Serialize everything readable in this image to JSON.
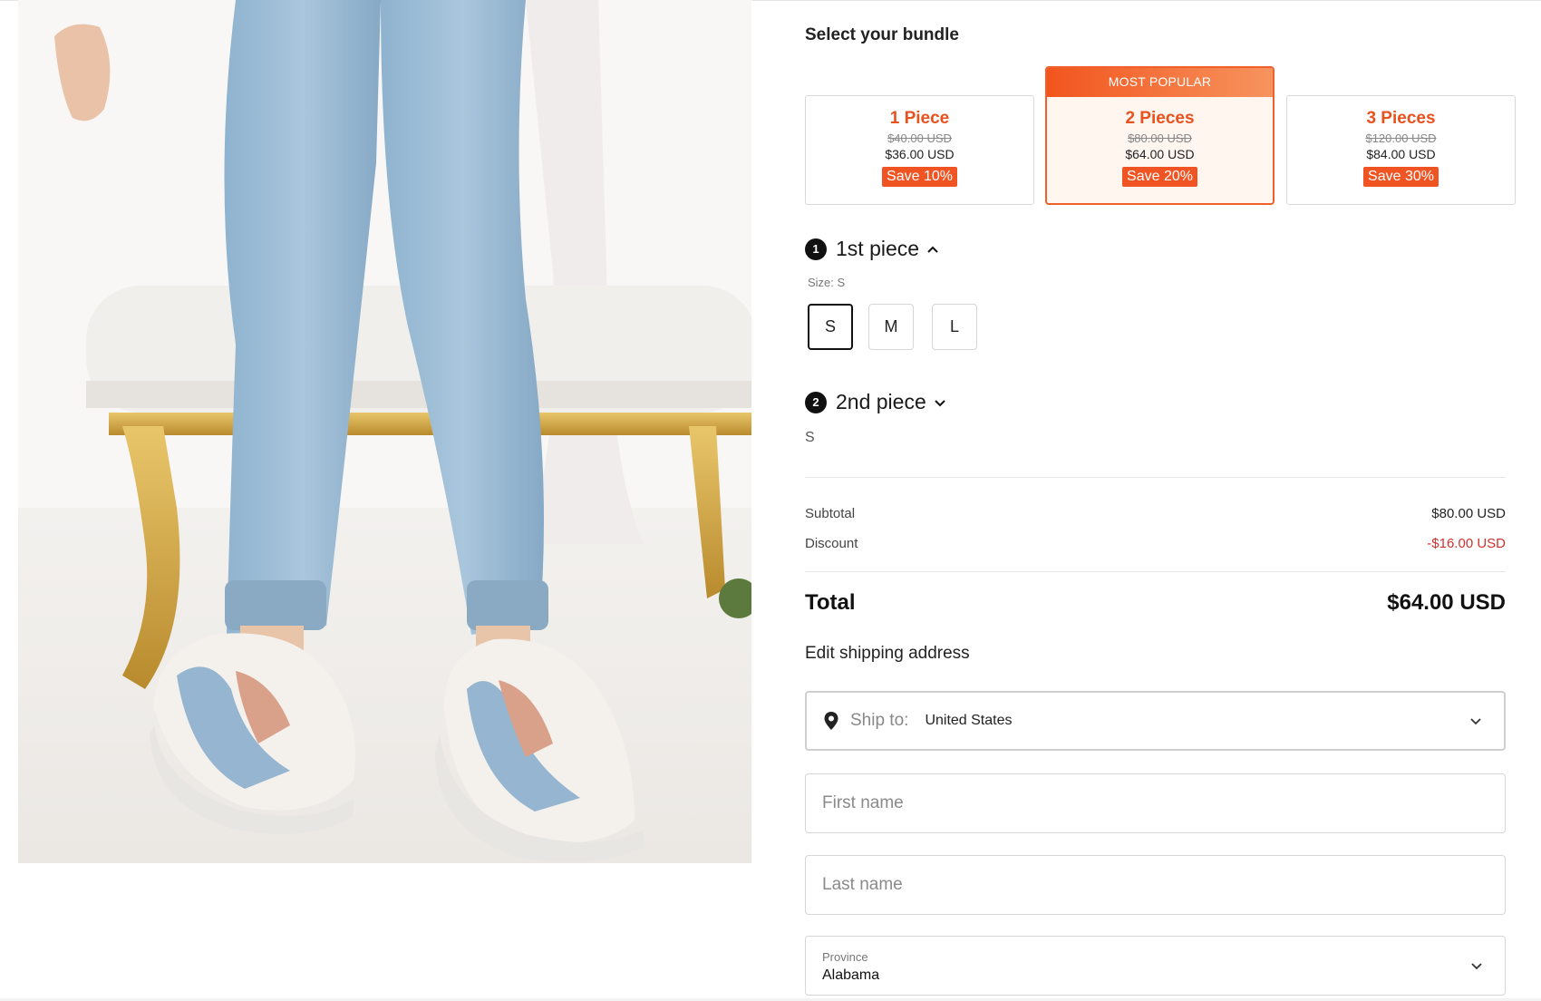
{
  "section": {
    "title": "Select your bundle"
  },
  "bundles": [
    {
      "title": "1 Piece",
      "old_price": "$40.00 USD",
      "new_price": "$36.00 USD",
      "save": "Save 10%"
    },
    {
      "ribbon": "MOST POPULAR",
      "title": "2 Pieces",
      "old_price": "$80.00 USD",
      "new_price": "$64.00 USD",
      "save": "Save 20%",
      "selected": true
    },
    {
      "title": "3 Pieces",
      "old_price": "$120.00 USD",
      "new_price": "$84.00 USD",
      "save": "Save 30%"
    }
  ],
  "piece1": {
    "number": "1",
    "label": "1st piece",
    "size_caption": "Size: S",
    "sizes": [
      "S",
      "M",
      "L"
    ],
    "selected_size": "S"
  },
  "piece2": {
    "number": "2",
    "label": "2nd piece",
    "value": "S"
  },
  "summary": {
    "subtotal_label": "Subtotal",
    "subtotal_value": "$80.00 USD",
    "discount_label": "Discount",
    "discount_value": "-$16.00 USD",
    "total_label": "Total",
    "total_value": "$64.00 USD"
  },
  "shipping": {
    "heading": "Edit shipping address",
    "ship_to_label": "Ship to:",
    "ship_to_value": "United States",
    "first_name_placeholder": "First name",
    "last_name_placeholder": "Last name",
    "province_label": "Province",
    "province_value": "Alabama"
  },
  "colors": {
    "accent": "#ef5422",
    "discount": "#d0312d",
    "selected_bundle_bg": "#fff6f0"
  },
  "icons": [
    "location-pin-icon",
    "chevron-up-icon",
    "chevron-down-icon"
  ]
}
